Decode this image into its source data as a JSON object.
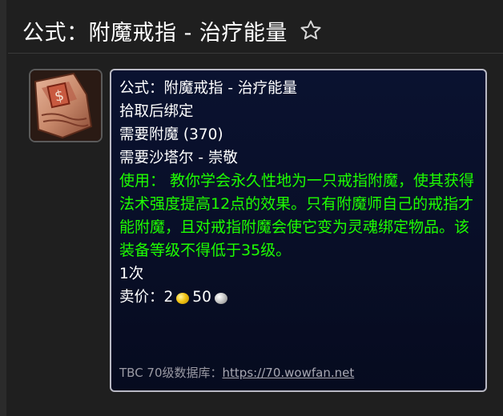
{
  "header": {
    "title": "公式：附魔戒指 - 治疗能量",
    "star_icon": "star-outline-icon"
  },
  "item": {
    "icon": "recipe-scroll-icon",
    "lines": {
      "name": "公式：附魔戒指 - 治疗能量",
      "bind": "拾取后绑定",
      "requires_skill": "需要附魔 (370)",
      "requires_rep": "需要沙塔尔 - 崇敬",
      "use_text": "使用： 教你学会永久性地为一只戒指附魔，使其获得法术强度提高12点的效果。只有附魔师自己的戒指才能附魔，且对戒指附魔会使它变为灵魂绑定物品。该装备等级不得低于35级。",
      "charges": "1次",
      "sell_label": "卖价：",
      "gold": "2",
      "silver": "50"
    },
    "footer": {
      "label": "TBC 70级数据库：",
      "link": "https://70.wowfan.net"
    }
  },
  "colors": {
    "background": "#1f1f1f",
    "tooltip_bg": "#0a1230",
    "tooltip_border": "#b9b9c4",
    "use_text": "#1eff00",
    "gold_coin": "#f2c414",
    "silver_coin": "#c9c9c9"
  }
}
